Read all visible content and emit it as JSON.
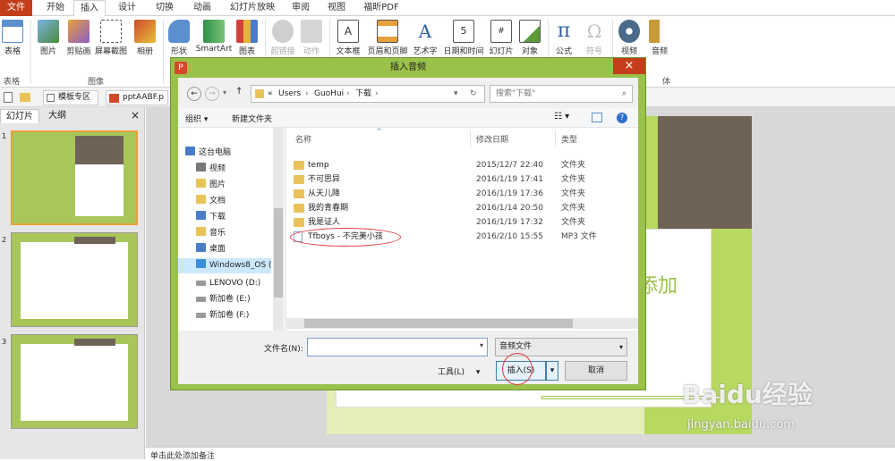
{
  "ribbon_tabs": [
    "文件",
    "开始",
    "插入",
    "设计",
    "切换",
    "动画",
    "幻灯片放映",
    "审阅",
    "视图",
    "福昕PDF"
  ],
  "ribbon_buttons": [
    {
      "label": "表格",
      "icon": "table-icon"
    },
    {
      "label": "图片",
      "icon": "picture-icon"
    },
    {
      "label": "剪贴画",
      "icon": "clipart-icon"
    },
    {
      "label": "屏幕截图",
      "icon": "screenshot-icon"
    },
    {
      "label": "相册",
      "icon": "photo-album-icon"
    },
    {
      "label": "形状",
      "icon": "shapes-icon"
    },
    {
      "label": "SmartArt",
      "icon": "smartart-icon"
    },
    {
      "label": "图表",
      "icon": "chart-icon"
    },
    {
      "label": "超链接",
      "icon": "hyperlink-icon"
    },
    {
      "label": "动作",
      "icon": "action-icon"
    },
    {
      "label": "文本框",
      "icon": "textbox-icon"
    },
    {
      "label": "页眉和页脚",
      "icon": "header-footer-icon"
    },
    {
      "label": "艺术字",
      "icon": "wordart-icon"
    },
    {
      "label": "日期和时间",
      "icon": "date-time-icon"
    },
    {
      "label": "幻灯片",
      "icon": "slide-number-icon"
    },
    {
      "label": "对象",
      "icon": "object-icon"
    },
    {
      "label": "公式",
      "icon": "equation-icon"
    },
    {
      "label": "符号",
      "icon": "symbol-icon"
    },
    {
      "label": "视频",
      "icon": "video-icon"
    },
    {
      "label": "音频",
      "icon": "audio-icon"
    }
  ],
  "ribbon_groups": {
    "tables": "表格",
    "images": "图像",
    "media": "体"
  },
  "doc_tabs": {
    "template": "模板专区",
    "file": "pptAABF.p"
  },
  "left_pane": {
    "tab_slides": "幻灯片",
    "tab_outline": "大纲",
    "slide_numbers": [
      "1",
      "2",
      "3"
    ]
  },
  "slide": {
    "placeholder_text": "添加"
  },
  "notes": {
    "placeholder": "单击此处添加备注"
  },
  "watermark": {
    "brand": "Baidu经验",
    "url": "jingyan.baidu.com"
  },
  "dialog": {
    "title": "插入音频",
    "address": {
      "root": "«",
      "path": [
        "Users",
        "GuoHui",
        "下载"
      ]
    },
    "search_placeholder": "搜索\"下载\"",
    "toolbar": {
      "organize": "组织 ▾",
      "new_folder": "新建文件夹"
    },
    "nav_items": [
      "这台电脑",
      "视频",
      "图片",
      "文档",
      "下载",
      "音乐",
      "桌面",
      "Windows8_OS (",
      "LENOVO (D:)",
      "新加卷 (E:)",
      "新加卷 (F:)"
    ],
    "columns": {
      "name": "名称",
      "date": "修改日期",
      "type": "类型"
    },
    "files": [
      {
        "name": "temp",
        "date": "2015/12/7 22:40",
        "type": "文件夹",
        "kind": "folder"
      },
      {
        "name": "不可思异",
        "date": "2016/1/19 17:41",
        "type": "文件夹",
        "kind": "folder"
      },
      {
        "name": "从天儿降",
        "date": "2016/1/19 17:36",
        "type": "文件夹",
        "kind": "folder"
      },
      {
        "name": "我的青春期",
        "date": "2016/1/14 20:50",
        "type": "文件夹",
        "kind": "folder"
      },
      {
        "name": "我是证人",
        "date": "2016/1/19 17:32",
        "type": "文件夹",
        "kind": "folder"
      },
      {
        "name": "Tfboys - 不完美小孩",
        "date": "2016/2/10 15:55",
        "type": "MP3 文件",
        "kind": "mp3"
      }
    ],
    "filename_label": "文件名(N):",
    "filename_value": "",
    "filetype": "音频文件",
    "tools": "工具(L)",
    "insert": "插入(S)",
    "cancel": "取消"
  },
  "colors": {
    "file_tab": "#c43e1c",
    "dialog_frame": "#9ac14a",
    "slide_green": "#a8c65a",
    "highlight_red": "#e0383b"
  }
}
